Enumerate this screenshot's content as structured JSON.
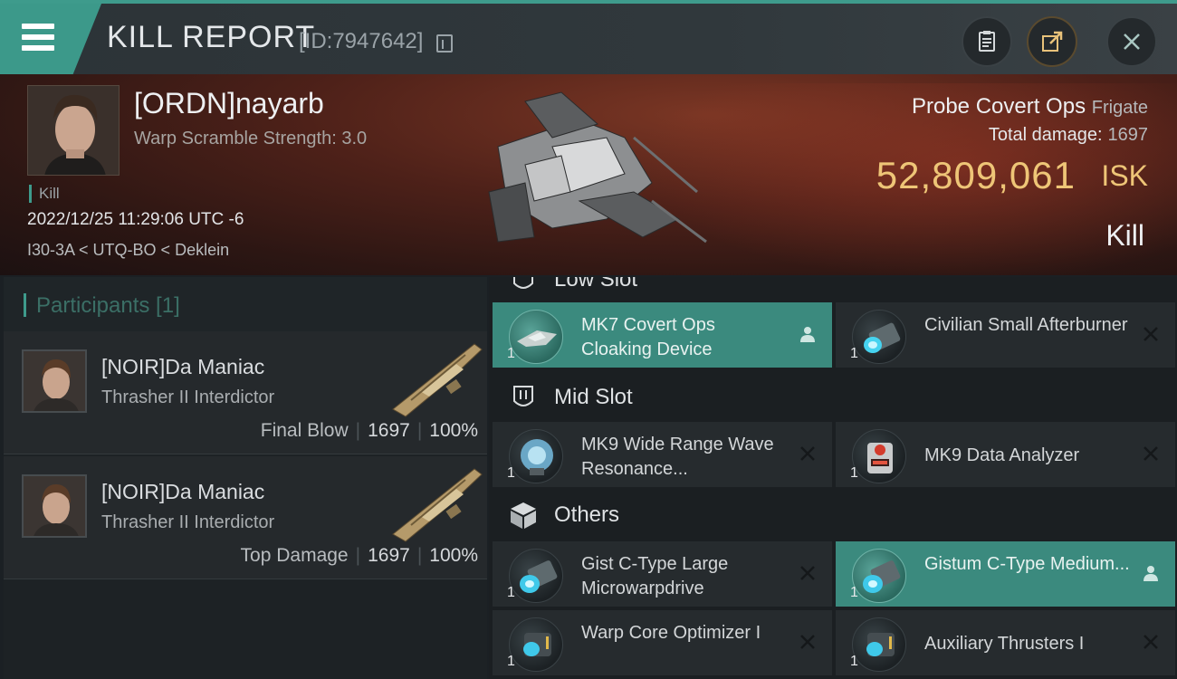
{
  "header": {
    "title": "KILL REPORT",
    "report_id": "[ID:7947642]"
  },
  "victim": {
    "pilot": "[ORDN]nayarb",
    "warp_scramble": "Warp Scramble Strength: 3.0",
    "kill_tag": "Kill",
    "datetime": "2022/12/25 11:29:06 UTC -6",
    "location": "I30-3A < UTQ-BO < Deklein",
    "ship_name": "Probe Covert Ops",
    "ship_class": "Frigate",
    "total_damage_label": "Total damage:",
    "total_damage": "1697",
    "isk_value": "52,809,061",
    "isk_unit": "ISK",
    "result": "Kill"
  },
  "participants": {
    "header": "Participants [1]",
    "items": [
      {
        "name": "[NOIR]Da Maniac",
        "ship": "Thrasher II Interdictor",
        "label": "Final Blow",
        "damage": "1697",
        "percent": "100%"
      },
      {
        "name": "[NOIR]Da Maniac",
        "ship": "Thrasher II Interdictor",
        "label": "Top Damage",
        "damage": "1697",
        "percent": "100%"
      }
    ]
  },
  "fitting": {
    "low_slot": {
      "title": "Low Slot",
      "modules": [
        {
          "name": "MK7 Covert Ops Cloaking Device",
          "qty": "1",
          "status": "person",
          "icon": "cloak-icon"
        },
        {
          "name": "Civilian Small Afterburner",
          "qty": "1",
          "status": "destroyed",
          "icon": "afterburner-icon"
        }
      ]
    },
    "mid_slot": {
      "title": "Mid Slot",
      "modules": [
        {
          "name": "MK9 Wide Range Wave Resonance...",
          "qty": "1",
          "status": "destroyed",
          "icon": "scanner-icon"
        },
        {
          "name": "MK9 Data Analyzer",
          "qty": "1",
          "status": "destroyed",
          "icon": "data-analyzer-icon"
        }
      ]
    },
    "others": {
      "title": "Others",
      "modules": [
        {
          "name": "Gist C-Type Large Microwarpdrive",
          "qty": "1",
          "status": "destroyed",
          "icon": "microwarpdrive-icon"
        },
        {
          "name": "Gistum C-Type Medium...",
          "qty": "1",
          "status": "person",
          "icon": "microwarpdrive-icon"
        },
        {
          "name": "Warp Core Optimizer I",
          "qty": "1",
          "status": "destroyed",
          "icon": "warp-core-icon"
        },
        {
          "name": "Auxiliary Thrusters I",
          "qty": "1",
          "status": "destroyed",
          "icon": "thruster-icon"
        }
      ]
    }
  },
  "colors": {
    "accent": "#3e9b8c",
    "isk": "#eec577",
    "highlight_row": "#3b8a7e"
  }
}
